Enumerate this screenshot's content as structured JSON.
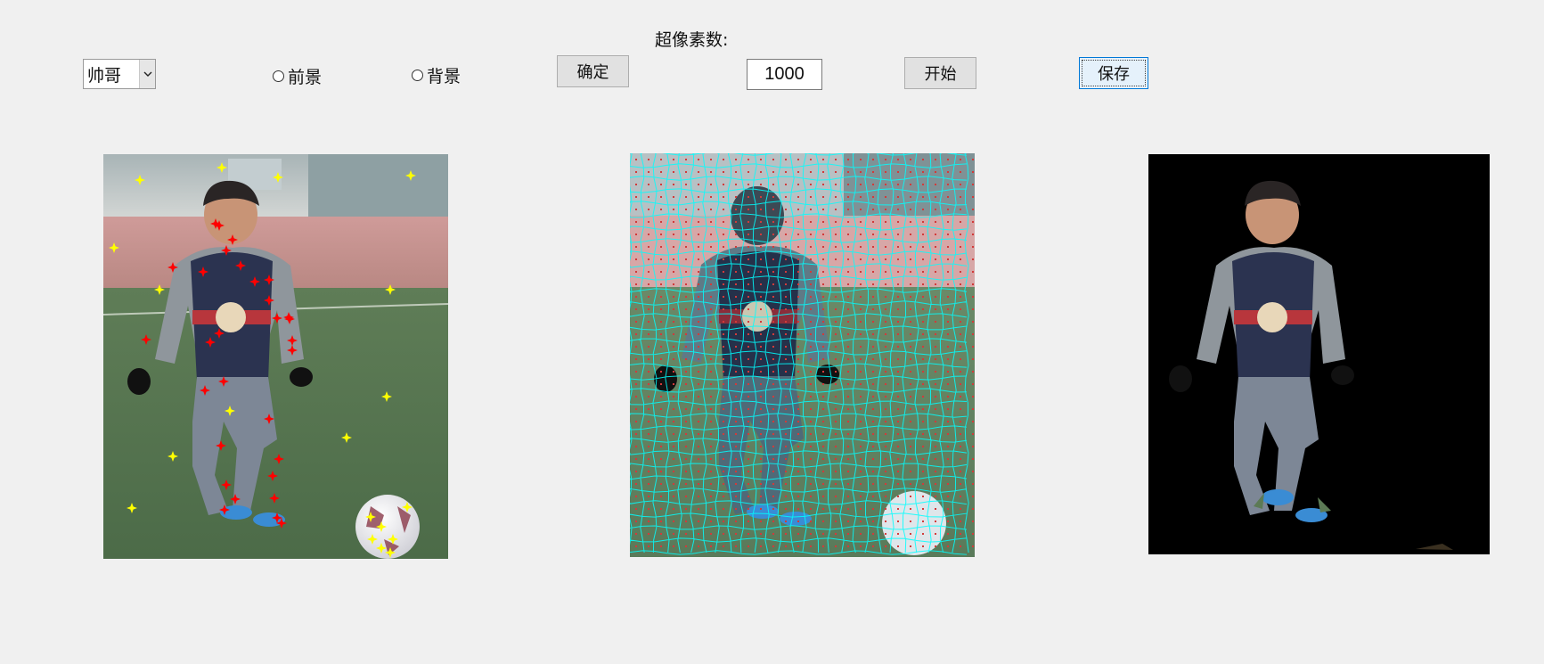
{
  "toolbar": {
    "name_select": {
      "value": "帅哥"
    },
    "radio_foreground": {
      "label": "前景"
    },
    "radio_background": {
      "label": "背景"
    },
    "confirm_button": {
      "label": "确定"
    },
    "superpixel": {
      "label": "超像素数:",
      "value": "1000"
    },
    "start_button": {
      "label": "开始"
    },
    "save_button": {
      "label": "保存"
    }
  },
  "colors": {
    "window_bg": "#f0f0f0",
    "foreground_marker": "#ff0000",
    "background_marker": "#ffff00",
    "superpixel_boundary": "#00ffff",
    "result_background": "#000000"
  },
  "icons": {
    "dropdown": "chevron-down-icon"
  }
}
